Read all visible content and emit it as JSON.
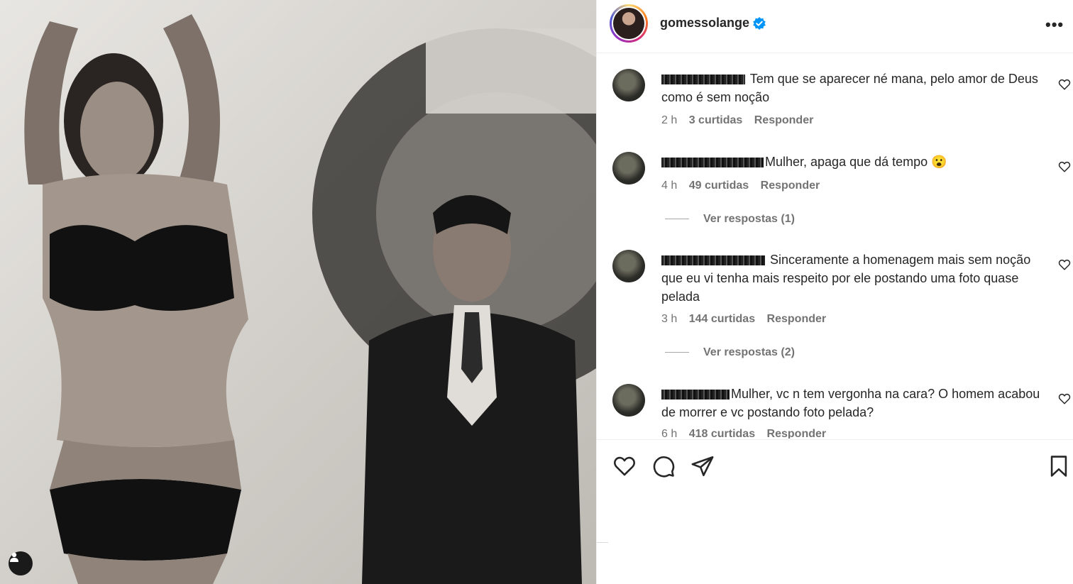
{
  "post": {
    "username": "gomessolange",
    "verified": true,
    "more_label": "•••"
  },
  "comments": [
    {
      "text": "Tem que se aparecer né mana, pelo amor de Deus como é sem noção",
      "time": "2 h",
      "likes": "3 curtidas",
      "reply_label": "Responder"
    },
    {
      "text": "Mulher, apaga que dá tempo 😮",
      "time": "4 h",
      "likes": "49 curtidas",
      "reply_label": "Responder",
      "view_replies": "Ver respostas (1)"
    },
    {
      "text": "Sinceramente a homenagem mais sem noção que eu vi tenha mais respeito por ele postando uma foto quase pelada",
      "time": "3 h",
      "likes": "144 curtidas",
      "reply_label": "Responder",
      "view_replies": "Ver respostas (2)"
    },
    {
      "text": "Mulher, vc n tem vergonha na cara? O homem acabou de morrer e vc postando foto pelada?",
      "time": "6 h",
      "likes": "418 curtidas",
      "reply_label": "Responder"
    }
  ],
  "colors": {
    "verified_badge": "#0095f6",
    "meta_text": "#737373",
    "border": "#efefef"
  },
  "icons": [
    "heart-icon",
    "comment-icon",
    "share-icon",
    "bookmark-icon",
    "user-tag-icon",
    "verified-icon",
    "more-icon"
  ]
}
